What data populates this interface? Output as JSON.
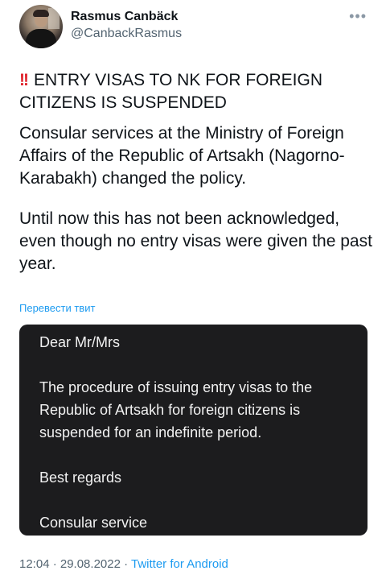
{
  "author": {
    "name": "Rasmus Canbäck",
    "handle": "@CanbackRasmus"
  },
  "tweet": {
    "title_prefix": "!!",
    "title": "ENTRY VISAS TO NK FOR FOREIGN CITIZENS IS SUSPENDED",
    "paragraph1": "Consular services at the Ministry of Foreign Affairs of the Republic of Artsakh (Nagorno-Karabakh) changed the policy.",
    "paragraph2": "Until now this has not been acknowledged, even though no entry visas were given the past year.",
    "translate_link": "Перевести твит"
  },
  "image_card": {
    "greeting": "Dear Mr/Mrs",
    "body": "The procedure of issuing entry visas to the Republic of Artsakh for foreign citizens is suspended for an indefinite period.",
    "closing": "Best regards",
    "signature": "Consular service"
  },
  "footer": {
    "time_date": "12:04 · 29.08.2022 · ",
    "source": "Twitter for Android"
  },
  "icons": {
    "more": "more-options-icon",
    "alert": "double-exclamation-icon"
  },
  "colors": {
    "link": "#1d9bf0",
    "alert": "#e0262e",
    "card_bg": "#1c1c1e",
    "muted": "#536471"
  }
}
